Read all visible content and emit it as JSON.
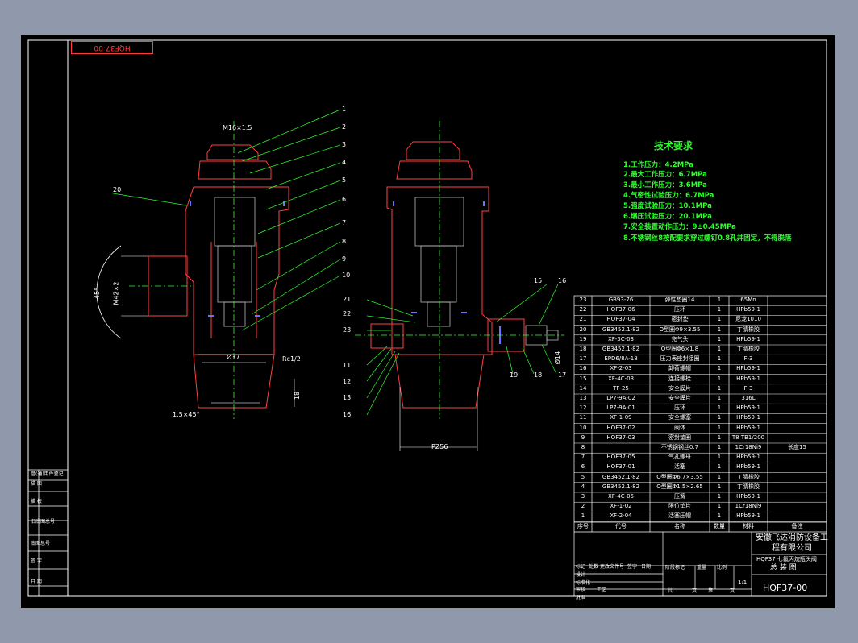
{
  "drawing": {
    "code": "HQF37-00",
    "code_mirrored": "HQF37-00",
    "company": "安徽飞达消防设备工程有限公司",
    "product": "HQF37 七氟丙烷瓶头阀",
    "view": "总 装 图",
    "scale": "1:1"
  },
  "tech": {
    "title": "技术要求",
    "items": [
      "1.工作压力：4.2MPa",
      "2.最大工作压力：6.7MPa",
      "3.最小工作压力：3.6MPa",
      "4.气密性试验压力：6.7MPa",
      "5.强度试验压力：10.1MPa",
      "6.爆压试验压力：20.1MPa",
      "7.安全装置动作压力：9±0.45MPa",
      "8.不锈钢丝8按配要求穿过螺钉0.8孔并固定，不得脱落"
    ]
  },
  "dims": {
    "thread_top": "M16×1.5",
    "d37": "Ø37",
    "rc": "Rc1/2",
    "m": "M42×2",
    "angle": "45°",
    "chamfer": "1.5×45°",
    "pz": "PZ56",
    "h": "18",
    "d14": "Ø14"
  },
  "balloons_right_top": [
    "1",
    "2",
    "3",
    "4",
    "5",
    "6",
    "7",
    "8",
    "9",
    "10"
  ],
  "balloons_left": [
    "20",
    "21",
    "22",
    "23",
    "11",
    "12",
    "13",
    "16"
  ],
  "balloons_side": [
    "15",
    "16",
    "19",
    "18",
    "17"
  ],
  "bom": {
    "headers": [
      "序号",
      "代号",
      "名称",
      "数量",
      "材料",
      "备注"
    ],
    "rows": [
      [
        "23",
        "GB93-76",
        "弹性垫圈14",
        "1",
        "65Mn",
        ""
      ],
      [
        "22",
        "HQF37-06",
        "压环",
        "1",
        "HPb59-1",
        ""
      ],
      [
        "21",
        "HQF37-04",
        "密封垫",
        "1",
        "尼龙1010",
        ""
      ],
      [
        "20",
        "GB3452.1-82",
        "O型圈Φ9×3.55",
        "1",
        "丁腈橡胶",
        ""
      ],
      [
        "19",
        "XF-3C-03",
        "充气头",
        "1",
        "HPb59-1",
        ""
      ],
      [
        "18",
        "GB3452.1-82",
        "O型圈Φ6×1.8",
        "1",
        "丁腈橡胶",
        ""
      ],
      [
        "17",
        "EPD6/8A-18",
        "压力表座封接圈",
        "1",
        "F-3",
        ""
      ],
      [
        "16",
        "XF-2-03",
        "卸荷螺帽",
        "1",
        "HPb59-1",
        ""
      ],
      [
        "15",
        "XF-4C-03",
        "连接螺栓",
        "1",
        "HPb59-1",
        ""
      ],
      [
        "14",
        "TF-25",
        "安全膜片",
        "1",
        "F-3",
        ""
      ],
      [
        "13",
        "LP7-9A-02",
        "安全膜片",
        "1",
        "316L",
        ""
      ],
      [
        "12",
        "LP7-9A-01",
        "压环",
        "1",
        "HPb59-1",
        ""
      ],
      [
        "11",
        "XF-1-09",
        "安全螺塞",
        "1",
        "HPb59-1",
        ""
      ],
      [
        "10",
        "HQF37-02",
        "阀体",
        "1",
        "HPb59-1",
        ""
      ],
      [
        "9",
        "HQF37-03",
        "密封垫圈",
        "1",
        "T8 TB1/200",
        ""
      ],
      [
        "8",
        "",
        "不锈钢钢丝0.7",
        "1",
        "1Cr18Ni9",
        "长度15"
      ],
      [
        "7",
        "HQF37-05",
        "气孔螺母",
        "1",
        "HPb59-1",
        ""
      ],
      [
        "6",
        "HQF37-01",
        "活塞",
        "1",
        "HPb59-1",
        ""
      ],
      [
        "5",
        "GB3452.1-82",
        "O型圈Φ6.7×3.55",
        "1",
        "丁腈橡胶",
        ""
      ],
      [
        "4",
        "GB3452.1-82",
        "O型圈Φ1.5×2.65",
        "1",
        "丁腈橡胶",
        ""
      ],
      [
        "3",
        "XF-4C-05",
        "压簧",
        "1",
        "HPb59-1",
        ""
      ],
      [
        "2",
        "XF-1-02",
        "限位垫片",
        "1",
        "1Cr18Ni9",
        ""
      ],
      [
        "1",
        "XF-2-04",
        "活塞压帽",
        "1",
        "HPb59-1",
        ""
      ]
    ]
  },
  "titleblock": {
    "labels": [
      "标记",
      "处数",
      "更改文件号",
      "签字",
      "日期",
      "设计",
      "标准化",
      "阶段标记",
      "重量",
      "比例",
      "审核",
      "工艺",
      "批准",
      "共",
      "页",
      "第",
      "页"
    ]
  },
  "sidebar": [
    "借(通)用件登记",
    "描 图",
    "描 校",
    "旧底图总号",
    "底图总号",
    "签 字",
    "日 期"
  ]
}
